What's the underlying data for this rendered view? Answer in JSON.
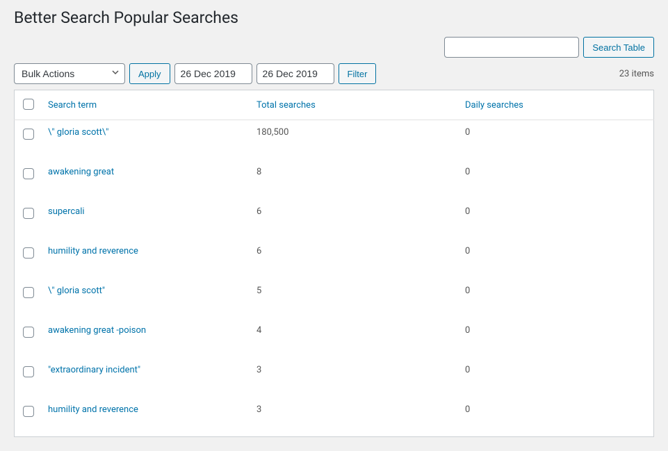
{
  "page": {
    "title": "Better Search Popular Searches"
  },
  "search": {
    "table_button": "Search Table"
  },
  "toolbar": {
    "bulk_label": "Bulk Actions",
    "apply_label": "Apply",
    "date_from": "26 Dec 2019",
    "date_to": "26 Dec 2019",
    "filter_label": "Filter",
    "item_count": "23 items"
  },
  "columns": {
    "term": "Search term",
    "total": "Total searches",
    "daily": "Daily searches"
  },
  "rows": [
    {
      "term": "\\\" gloria scott\\\"",
      "total": "180,500",
      "daily": "0"
    },
    {
      "term": "awakening great",
      "total": "8",
      "daily": "0"
    },
    {
      "term": "supercali",
      "total": "6",
      "daily": "0"
    },
    {
      "term": "humility and reverence",
      "total": "6",
      "daily": "0"
    },
    {
      "term": "\\\" gloria scott\"",
      "total": "5",
      "daily": "0"
    },
    {
      "term": "awakening great -poison",
      "total": "4",
      "daily": "0"
    },
    {
      "term": "\"extraordinary incident\"",
      "total": "3",
      "daily": "0"
    },
    {
      "term": "humility and reverence",
      "total": "3",
      "daily": "0"
    }
  ]
}
